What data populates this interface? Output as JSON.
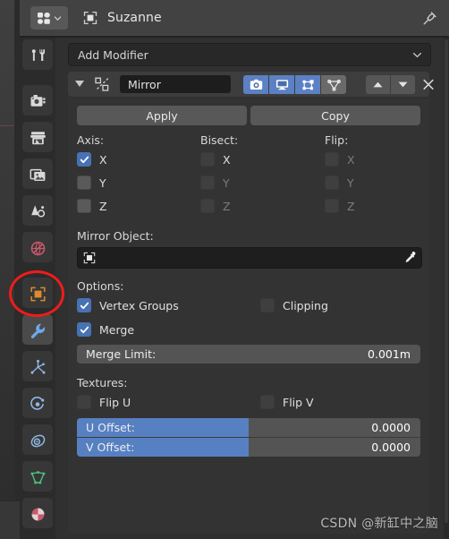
{
  "header": {
    "editor_type_icon": "properties-editor-icon",
    "object_icon": "object-icon",
    "breadcrumb_name": "Suzanne",
    "pin_icon": "pin-icon"
  },
  "tabs": [
    {
      "name": "tool",
      "icon": "tool-icon",
      "selected": false
    },
    {
      "name": "render",
      "icon": "camera-back-icon",
      "selected": false
    },
    {
      "name": "output",
      "icon": "printer-icon",
      "selected": false
    },
    {
      "name": "view-layer",
      "icon": "images-icon",
      "selected": false
    },
    {
      "name": "scene",
      "icon": "scene-cone-icon",
      "selected": false
    },
    {
      "name": "world",
      "icon": "world-globe-icon",
      "selected": false
    },
    {
      "name": "object",
      "icon": "object-square-icon",
      "selected": false
    },
    {
      "name": "modifiers",
      "icon": "wrench-icon",
      "selected": true
    },
    {
      "name": "particles",
      "icon": "particles-icon",
      "selected": false
    },
    {
      "name": "physics",
      "icon": "physics-orbit-icon",
      "selected": false
    },
    {
      "name": "constraints",
      "icon": "constraint-icon",
      "selected": false
    },
    {
      "name": "object-data",
      "icon": "mesh-data-icon",
      "selected": false
    },
    {
      "name": "material",
      "icon": "material-ball-icon",
      "selected": false
    }
  ],
  "add_modifier": {
    "label": "Add Modifier",
    "chevron_icon": "chevron-down-icon"
  },
  "modifier": {
    "expand_icon": "triangle-down-icon",
    "type_icon": "mirror-modifier-icon",
    "name": "Mirror",
    "toggles": [
      {
        "name": "render",
        "icon": "camera-icon",
        "on": true
      },
      {
        "name": "viewport",
        "icon": "monitor-icon",
        "on": true
      },
      {
        "name": "edit-mode",
        "icon": "edit-mode-icon",
        "on": true
      },
      {
        "name": "on-cage",
        "icon": "vertex-cage-icon",
        "on": false
      }
    ],
    "move_up_icon": "triangle-up-icon",
    "move_down_icon": "triangle-down-icon",
    "close_icon": "x-icon",
    "apply_label": "Apply",
    "copy_label": "Copy",
    "axis": {
      "label": "Axis:",
      "items": [
        {
          "label": "X",
          "checked": true,
          "enabled": true
        },
        {
          "label": "Y",
          "checked": false,
          "enabled": true
        },
        {
          "label": "Z",
          "checked": false,
          "enabled": true
        }
      ]
    },
    "bisect": {
      "label": "Bisect:",
      "items": [
        {
          "label": "X",
          "checked": false,
          "enabled": true
        },
        {
          "label": "Y",
          "checked": false,
          "enabled": false
        },
        {
          "label": "Z",
          "checked": false,
          "enabled": false
        }
      ]
    },
    "flip": {
      "label": "Flip:",
      "items": [
        {
          "label": "X",
          "checked": false,
          "enabled": false
        },
        {
          "label": "Y",
          "checked": false,
          "enabled": false
        },
        {
          "label": "Z",
          "checked": false,
          "enabled": false
        }
      ]
    },
    "mirror_object": {
      "label": "Mirror Object:",
      "value": "",
      "object_icon": "object-icon",
      "eyedropper_icon": "eyedropper-icon"
    },
    "options": {
      "label": "Options:",
      "vertex_groups": {
        "label": "Vertex Groups",
        "checked": true
      },
      "clipping": {
        "label": "Clipping",
        "checked": false
      },
      "merge": {
        "label": "Merge",
        "checked": true
      },
      "merge_limit": {
        "label": "Merge Limit:",
        "value": "0.001m",
        "fill_percent": 0
      }
    },
    "textures": {
      "label": "Textures:",
      "flip_u": {
        "label": "Flip U",
        "checked": false
      },
      "flip_v": {
        "label": "Flip V",
        "checked": false
      },
      "u_offset": {
        "label": "U Offset:",
        "value": "0.0000",
        "fill_percent": 50
      },
      "v_offset": {
        "label": "V Offset:",
        "value": "0.0000",
        "fill_percent": 50
      }
    }
  },
  "annotation": {
    "shape": "red-ellipse",
    "color": "#ee1c1c",
    "target": "modifiers-tab"
  },
  "watermark": "CSDN @新缸中之脑",
  "colors": {
    "accent_blue": "#5680c2",
    "checkbox_blue": "#4772b3",
    "panel_bg": "#303030",
    "card_bg": "#333333",
    "header_bg": "#424242",
    "annotation_red": "#ee1c1c"
  }
}
